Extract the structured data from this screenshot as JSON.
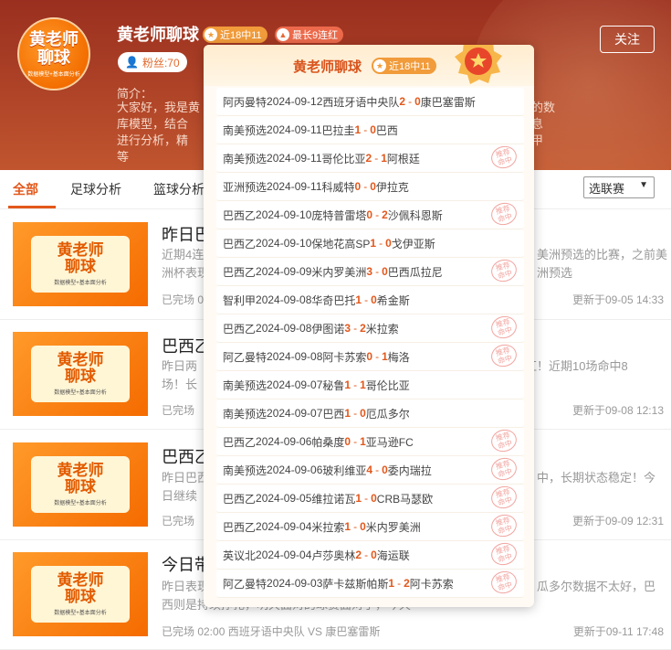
{
  "header": {
    "avatar_line1": "黄老师",
    "avatar_line2": "聊球",
    "avatar_sub": "数据模型+基本面分析",
    "title": "黄老师聊球",
    "badge_recent": "近18中11",
    "badge_streak": "最长9连红",
    "fans": "粉丝:70",
    "follow_label": "关注",
    "intro_label": "简介：",
    "intro_lines": [
      "大家好，我是黄",
      "库模型，结合",
      "进行分析，精",
      "等"
    ],
    "intro_right": [
      "的数",
      "息",
      "甲"
    ]
  },
  "tabs": {
    "items": [
      "全部",
      "足球分析",
      "篮球分析"
    ],
    "active": "全部",
    "select_label": "选联赛"
  },
  "articles": [
    {
      "title": "昨日巴",
      "desc": [
        "近期4连",
        "洲杯表现"
      ],
      "desc_right": [
        "美洲预选的比赛，之前美"
      ],
      "meta": "已完场 0",
      "updated": "更新于09-05 14:33"
    },
    {
      "title": "巴西乙",
      "desc": [
        "昨日两",
        "场！长"
      ],
      "desc_right": [
        "红！近期10场命中8"
      ],
      "meta": "已完场",
      "updated": "更新于09-08 12:13"
    },
    {
      "title": "巴西乙",
      "desc": [
        "昨日巴西",
        "日继续"
      ],
      "desc_right": [
        "中，长期状态稳定！今"
      ],
      "meta": "已完场",
      "updated": "更新于09-09 12:31"
    },
    {
      "title": "今日带",
      "desc": [
        "昨日表现",
        "西则是持续挣扎，明天面对的球赛面对了，今天"
      ],
      "desc_right": [
        "瓜多尔数据不太好，巴"
      ],
      "meta": "已完场 02:00 西班牙语中央队 VS 康巴塞雷斯",
      "updated": "更新于09-11 17:48"
    }
  ],
  "popup": {
    "title": "黄老师聊球",
    "badge": "近18中11",
    "stamp_text": [
      "推荐",
      "命中"
    ],
    "rows": [
      {
        "league": "阿丙曼特",
        "date": "2024-09-12",
        "home": "西班牙语中央队",
        "hs": "2",
        "as": "0",
        "away": "康巴塞雷斯",
        "hit": false
      },
      {
        "league": "南美预选",
        "date": "2024-09-11",
        "home": "巴拉圭",
        "hs": "1",
        "as": "0",
        "away": "巴西",
        "hit": false
      },
      {
        "league": "南美预选",
        "date": "2024-09-11",
        "home": "哥伦比亚",
        "hs": "2",
        "as": "1",
        "away": "阿根廷",
        "hit": true
      },
      {
        "league": "亚洲预选",
        "date": "2024-09-11",
        "home": "科威特",
        "hs": "0",
        "as": "0",
        "away": "伊拉克",
        "hit": false
      },
      {
        "league": "巴西乙",
        "date": "2024-09-10",
        "home": "庞特普雷塔",
        "hs": "0",
        "as": "2",
        "away": "沙佩科恩斯",
        "hit": true
      },
      {
        "league": "巴西乙",
        "date": "2024-09-10",
        "home": "保地花高SP",
        "hs": "1",
        "as": "0",
        "away": "戈伊亚斯",
        "hit": false
      },
      {
        "league": "巴西乙",
        "date": "2024-09-09",
        "home": "米内罗美洲",
        "hs": "3",
        "as": "0",
        "away": "巴西瓜拉尼",
        "hit": true
      },
      {
        "league": "智利甲",
        "date": "2024-09-08",
        "home": "华奇巴托",
        "hs": "1",
        "as": "0",
        "away": "希金斯",
        "hit": false
      },
      {
        "league": "巴西乙",
        "date": "2024-09-08",
        "home": "伊图诺",
        "hs": "3",
        "as": "2",
        "away": "米拉索",
        "hit": true
      },
      {
        "league": "阿乙曼特",
        "date": "2024-09-08",
        "home": "阿卡苏索",
        "hs": "0",
        "as": "1",
        "away": "梅洛",
        "hit": true
      },
      {
        "league": "南美预选",
        "date": "2024-09-07",
        "home": "秘鲁",
        "hs": "1",
        "as": "1",
        "away": "哥伦比亚",
        "hit": false
      },
      {
        "league": "南美预选",
        "date": "2024-09-07",
        "home": "巴西",
        "hs": "1",
        "as": "0",
        "away": "厄瓜多尔",
        "hit": false
      },
      {
        "league": "巴西乙",
        "date": "2024-09-06",
        "home": "帕桑度",
        "hs": "0",
        "as": "1",
        "away": "亚马逊FC",
        "hit": true
      },
      {
        "league": "南美预选",
        "date": "2024-09-06",
        "home": "玻利维亚",
        "hs": "4",
        "as": "0",
        "away": "委内瑞拉",
        "hit": true
      },
      {
        "league": "巴西乙",
        "date": "2024-09-05",
        "home": "维拉诺瓦",
        "hs": "1",
        "as": "0",
        "away": "CRB马瑟欧",
        "hit": true
      },
      {
        "league": "巴西乙",
        "date": "2024-09-04",
        "home": "米拉索",
        "hs": "1",
        "as": "0",
        "away": "米内罗美洲",
        "hit": true
      },
      {
        "league": "英议北",
        "date": "2024-09-04",
        "home": "卢莎奥林",
        "hs": "2",
        "as": "0",
        "away": "海运联",
        "hit": true
      },
      {
        "league": "阿乙曼特",
        "date": "2024-09-03",
        "home": "萨卡兹斯帕斯",
        "hs": "1",
        "as": "2",
        "away": "阿卡苏索",
        "hit": true
      }
    ]
  }
}
